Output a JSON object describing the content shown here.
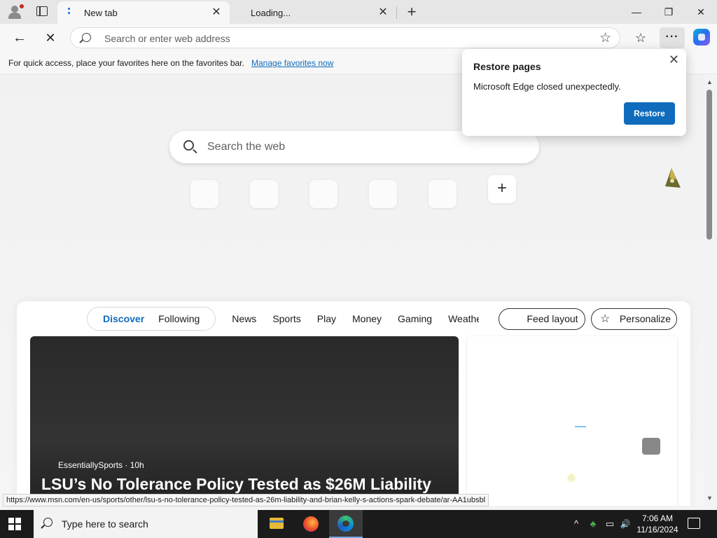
{
  "browser": {
    "tabs": [
      {
        "title": "New tab",
        "close": "✕"
      },
      {
        "title": "Loading...",
        "close": "✕"
      }
    ],
    "new_tab_glyph": "+",
    "window_controls": {
      "minimize": "—",
      "maximize": "❐",
      "close": "✕"
    },
    "nav": {
      "back": "←",
      "stop": "✕"
    },
    "address_placeholder": "Search or enter web address",
    "favorite_star": "☆",
    "favorites_glyph": "☆",
    "more_glyph": "···"
  },
  "favorites_bar": {
    "hint": "For quick access, place your favorites here on the favorites bar.",
    "link": "Manage favorites now"
  },
  "new_tab_page": {
    "search_placeholder": "Search the web",
    "add_shortcut_glyph": "+"
  },
  "feed": {
    "primary_tabs": [
      "Discover",
      "Following"
    ],
    "categories": [
      "News",
      "Sports",
      "Play",
      "Money",
      "Gaming",
      "Weathe"
    ],
    "feed_layout_label": "Feed layout",
    "personalize_label": "Personalize",
    "hero": {
      "source": "EssentiallySports · 10h",
      "headline": "LSU’s No Tolerance Policy Tested as $26M Liability"
    }
  },
  "status_url": "https://www.msn.com/en-us/sports/other/lsu-s-no-tolerance-policy-tested-as-26m-liability-and-brian-kelly-s-actions-spark-debate/ar-AA1ubsbl",
  "restore_popup": {
    "title": "Restore pages",
    "message": "Microsoft Edge closed unexpectedly.",
    "button": "Restore",
    "close": "✕"
  },
  "taskbar": {
    "search_placeholder": "Type here to search",
    "time": "7:06 AM",
    "date": "11/16/2024",
    "tray_chevron": "^",
    "volume_glyph": "🔊"
  },
  "colors": {
    "accent": "#0f6cbd",
    "taskbar": "#1b1b1b"
  }
}
